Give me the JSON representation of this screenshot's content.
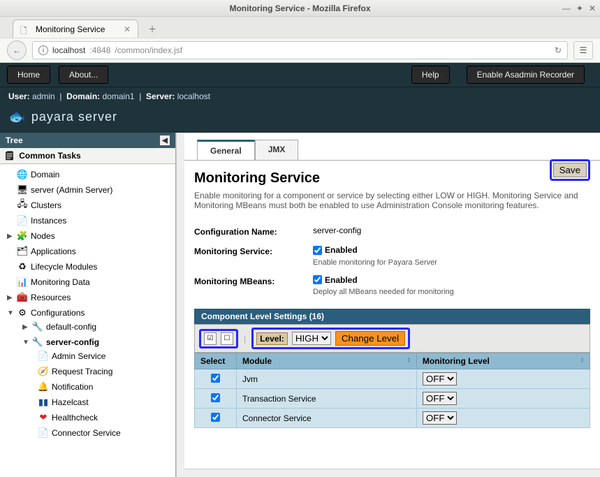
{
  "window": {
    "title": "Monitoring Service - Mozilla Firefox"
  },
  "browser": {
    "tab_title": "Monitoring Service",
    "url_host": "localhost",
    "url_port": ":4848",
    "url_path": "/common/index.jsf"
  },
  "menubar": {
    "home": "Home",
    "about": "About...",
    "help": "Help",
    "recorder": "Enable Asadmin Recorder"
  },
  "status": {
    "user_label": "User:",
    "user": "admin",
    "domain_label": "Domain:",
    "domain": "domain1",
    "server_label": "Server:",
    "server": "localhost"
  },
  "brand": "payara server",
  "sidebar": {
    "title": "Tree",
    "common_tasks": "Common Tasks",
    "items": {
      "domain": "Domain",
      "server": "server (Admin Server)",
      "clusters": "Clusters",
      "instances": "Instances",
      "nodes": "Nodes",
      "applications": "Applications",
      "lifecycle": "Lifecycle Modules",
      "monitoring_data": "Monitoring Data",
      "resources": "Resources",
      "configurations": "Configurations",
      "default_config": "default-config",
      "server_config": "server-config",
      "admin_service": "Admin Service",
      "request_tracing": "Request Tracing",
      "notification": "Notification",
      "hazelcast": "Hazelcast",
      "healthcheck": "Healthcheck",
      "connector_service": "Connector Service"
    }
  },
  "main": {
    "tabs": {
      "general": "General",
      "jmx": "JMX"
    },
    "title": "Monitoring Service",
    "save": "Save",
    "description": "Enable monitoring for a component or service by selecting either LOW or HIGH. Monitoring Service and Monitoring MBeans must both be enabled to use Administration Console monitoring features.",
    "config_name_label": "Configuration Name:",
    "config_name_value": "server-config",
    "monitoring_service_label": "Monitoring Service:",
    "monitoring_service_enabled": "Enabled",
    "monitoring_service_hint": "Enable monitoring for Payara Server",
    "mbeans_label": "Monitoring MBeans:",
    "mbeans_enabled": "Enabled",
    "mbeans_hint": "Deploy all MBeans needed for monitoring",
    "panel_title": "Component Level Settings (16)",
    "level_label": "Level:",
    "level_value": "HIGH",
    "change_level": "Change Level",
    "columns": {
      "select": "Select",
      "module": "Module",
      "monitoring_level": "Monitoring Level"
    },
    "rows": [
      {
        "module": "Jvm",
        "level": "OFF",
        "checked": true
      },
      {
        "module": "Transaction Service",
        "level": "OFF",
        "checked": true
      },
      {
        "module": "Connector Service",
        "level": "OFF",
        "checked": true
      }
    ]
  }
}
